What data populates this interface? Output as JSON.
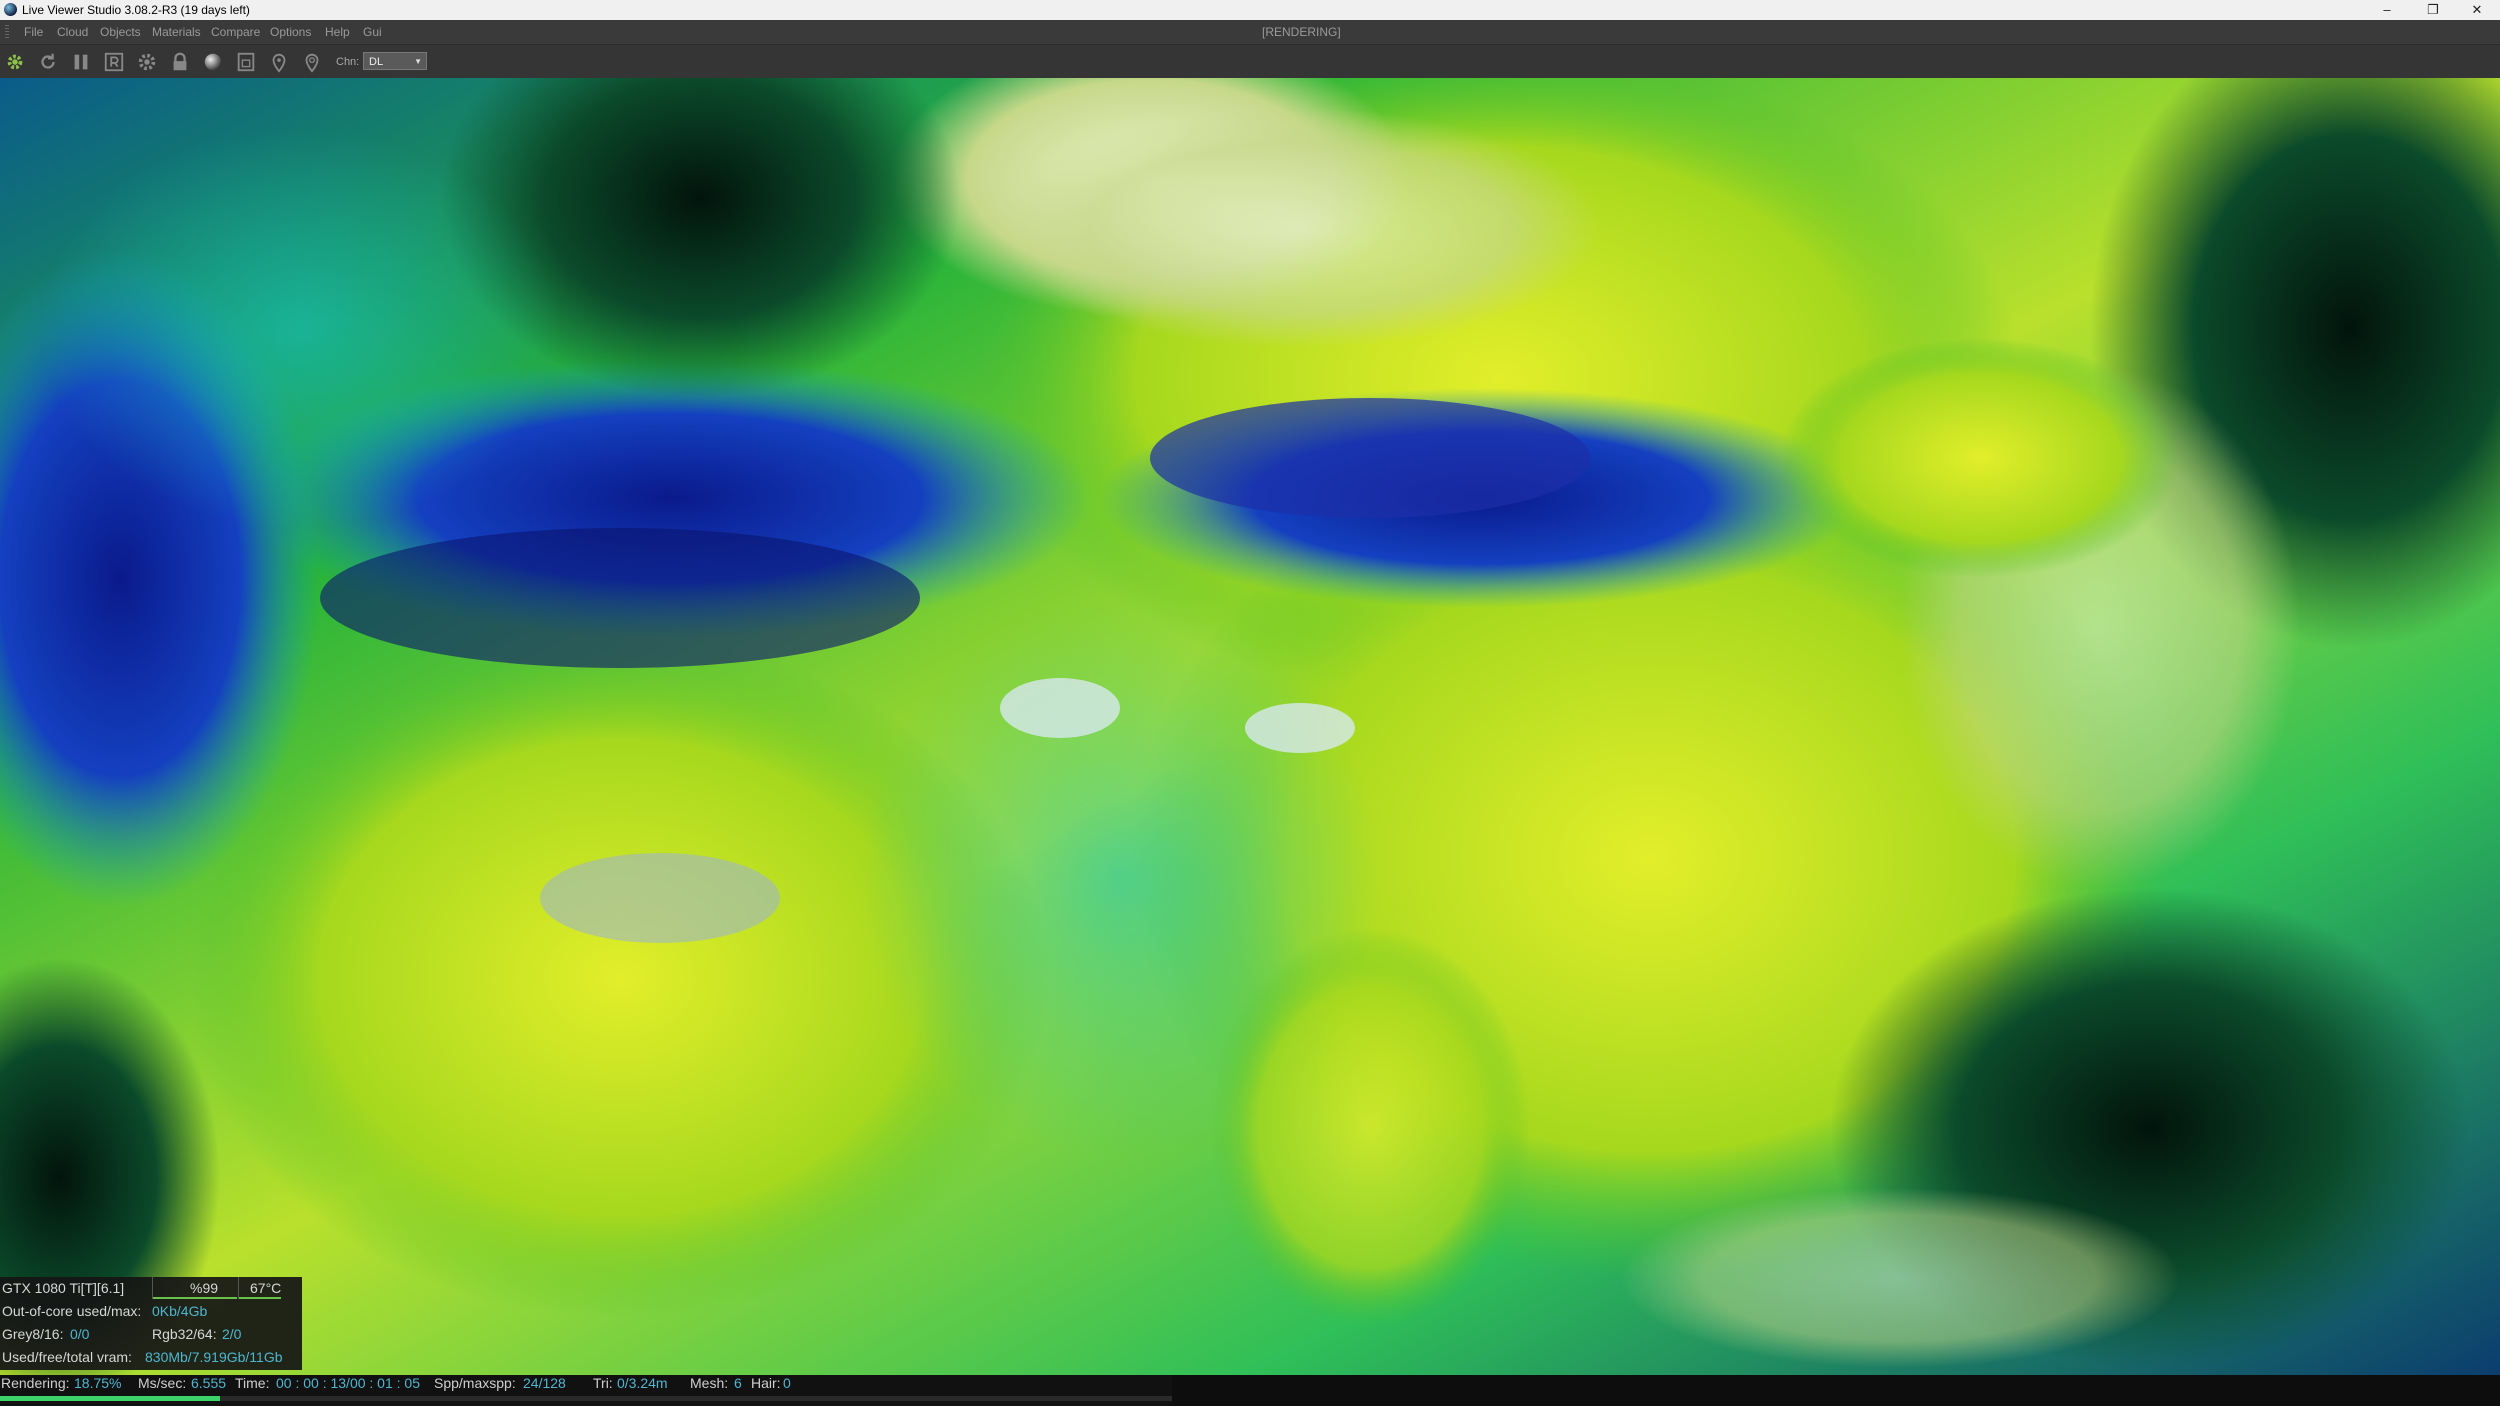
{
  "window": {
    "title": "Live Viewer Studio 3.08.2-R3 (19 days left)",
    "controls": {
      "minimize": "–",
      "maximize": "❐",
      "close": "✕"
    }
  },
  "menu": {
    "items": [
      "File",
      "Cloud",
      "Objects",
      "Materials",
      "Compare",
      "Options",
      "Help",
      "Gui"
    ],
    "render_state": "[RENDERING]"
  },
  "toolbar": {
    "icons": [
      "gear-icon",
      "restart-icon",
      "pause-icon",
      "region-icon",
      "settings-icon",
      "lock-icon",
      "sphere-icon",
      "focus-icon",
      "pick-icon",
      "pin-icon"
    ],
    "channel_label": "Chn:",
    "channel_value": "DL"
  },
  "gpu_stats": {
    "device": "GTX 1080 Ti[T][6.1]",
    "usage": "%99",
    "temperature": "67°C",
    "out_of_core_label": "Out-of-core used/max:",
    "out_of_core_value": "0Kb/4Gb",
    "grey_label": "Grey8/16:",
    "grey_value": "0/0",
    "rgb_label": "Rgb32/64:",
    "rgb_value": "2/0",
    "vram_label": "Used/free/total vram:",
    "vram_value": "830Mb/7.919Gb/11Gb",
    "usage_fraction": 0.99,
    "temp_fraction": 0.67
  },
  "status": {
    "rendering_label": "Rendering:",
    "rendering_value": "18.75%",
    "progress_fraction": 0.1875,
    "ms_label": "Ms/sec:",
    "ms_value": "6.555",
    "time_label": "Time:",
    "time_value": "00 : 00 : 13/00 : 01 : 05",
    "spp_label": "Spp/maxspp:",
    "spp_value": "24/128",
    "tri_label": "Tri:",
    "tri_value": "0/3.24m",
    "mesh_label": "Mesh:",
    "mesh_value": "6",
    "hair_label": "Hair:",
    "hair_value": "0"
  },
  "colors": {
    "progress": "#3bd36a",
    "highlight": "#4fb6d0"
  }
}
